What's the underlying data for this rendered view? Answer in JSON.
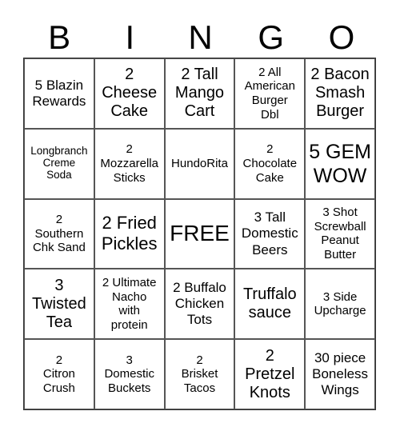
{
  "header": [
    "B",
    "I",
    "N",
    "G",
    "O"
  ],
  "cells": [
    {
      "text": "5 Blazin\nRewards",
      "size": "s17"
    },
    {
      "text": "2\nCheese\nCake",
      "size": "s20"
    },
    {
      "text": "2 Tall\nMango\nCart",
      "size": "s20"
    },
    {
      "text": "2 All\nAmerican\nBurger\nDbl",
      "size": "s14"
    },
    {
      "text": "2 Bacon\nSmash\nBurger",
      "size": "s20"
    },
    {
      "text": "Longbranch\nCreme\nSoda",
      "size": "s13"
    },
    {
      "text": "2\nMozzarella\nSticks",
      "size": "s14"
    },
    {
      "text": "HundoRita",
      "size": "s14"
    },
    {
      "text": "2\nChocolate\nCake",
      "size": "s14"
    },
    {
      "text": "5 GEM\nWOW",
      "size": "s24"
    },
    {
      "text": "2\nSouthern\nChk Sand",
      "size": "s14"
    },
    {
      "text": "2 Fried\nPickles",
      "size": "s22"
    },
    {
      "text": "FREE",
      "size": "s28"
    },
    {
      "text": "3 Tall\nDomestic\nBeers",
      "size": "s17"
    },
    {
      "text": "3 Shot\nScrewball\nPeanut\nButter",
      "size": "s14"
    },
    {
      "text": "3\nTwisted\nTea",
      "size": "s20"
    },
    {
      "text": "2 Ultimate\nNacho\nwith\nprotein",
      "size": "s14"
    },
    {
      "text": "2 Buffalo\nChicken\nTots",
      "size": "s17"
    },
    {
      "text": "Truffalo\nsauce",
      "size": "s20"
    },
    {
      "text": "3 Side\nUpcharge",
      "size": "s14"
    },
    {
      "text": "2\nCitron\nCrush",
      "size": "s14"
    },
    {
      "text": "3\nDomestic\nBuckets",
      "size": "s14"
    },
    {
      "text": "2\nBrisket\nTacos",
      "size": "s14"
    },
    {
      "text": "2\nPretzel\nKnots",
      "size": "s20"
    },
    {
      "text": "30 piece\nBoneless\nWings",
      "size": "s17"
    }
  ]
}
